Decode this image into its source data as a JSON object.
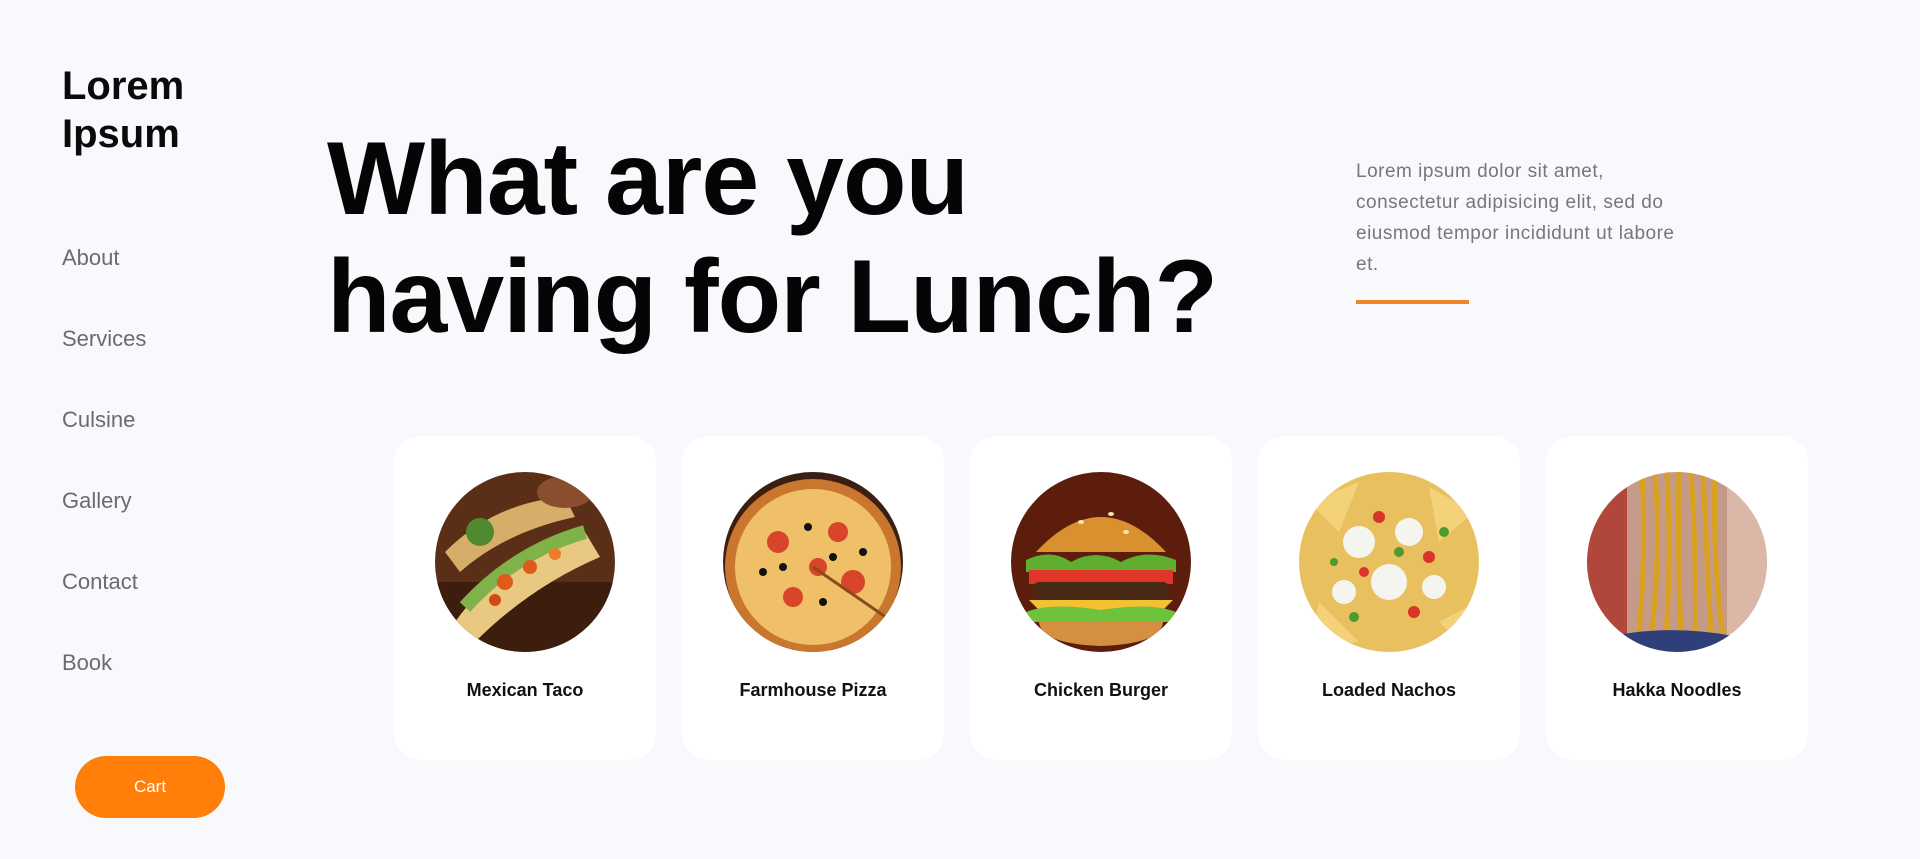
{
  "brand": {
    "logo_text": "Lorem\nIpsum"
  },
  "nav": {
    "items": [
      {
        "label": "About"
      },
      {
        "label": "Services"
      },
      {
        "label": "Culsine"
      },
      {
        "label": "Gallery"
      },
      {
        "label": "Contact"
      },
      {
        "label": "Book"
      }
    ]
  },
  "cart": {
    "label": "Cart"
  },
  "hero": {
    "headline": "What are you having for Lunch?",
    "intro": "Lorem ipsum dolor sit amet, consectetur adipisicing elit, sed do eiusmod tempor incididunt ut labore et."
  },
  "menu": {
    "items": [
      {
        "name": "Mexican Taco",
        "icon": "taco-photo"
      },
      {
        "name": "Farmhouse Pizza",
        "icon": "pizza-photo"
      },
      {
        "name": "Chicken Burger",
        "icon": "burger-photo"
      },
      {
        "name": "Loaded Nachos",
        "icon": "nachos-photo"
      },
      {
        "name": "Hakka Noodles",
        "icon": "noodles-photo"
      }
    ]
  },
  "colors": {
    "accent": "#ff7f0a",
    "background": "#f8f9fd",
    "card": "#ffffff",
    "heading": "#050505",
    "muted_text": "#777777"
  }
}
